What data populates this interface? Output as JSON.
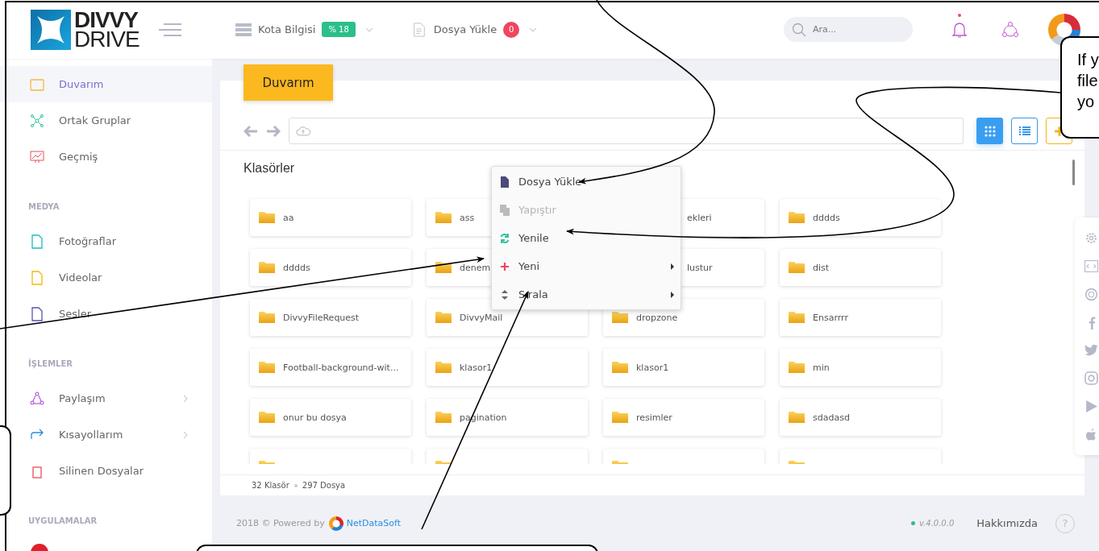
{
  "header": {
    "logo": {
      "line1": "DIVVY",
      "line2": "DRIVE"
    },
    "quota": {
      "label": "Kota Bilgisi",
      "badge": "% 18"
    },
    "upload": {
      "label": "Dosya Yükle",
      "badge": "0"
    },
    "search": {
      "placeholder": "Ara..."
    },
    "has_notification": true
  },
  "sidebar": {
    "sections": [
      {
        "items": [
          {
            "label": "Duvarım",
            "kind": "wall",
            "selected": true,
            "has_submenu": false
          },
          {
            "label": "Ortak Gruplar",
            "kind": "groups",
            "selected": false,
            "has_submenu": false
          },
          {
            "label": "Geçmiş",
            "kind": "history",
            "selected": false,
            "has_submenu": false
          }
        ]
      },
      {
        "title": "MEDYA",
        "items": [
          {
            "label": "Fotoğraflar",
            "kind": "photos",
            "selected": false,
            "has_submenu": false
          },
          {
            "label": "Videolar",
            "kind": "videos",
            "selected": false,
            "has_submenu": false
          },
          {
            "label": "Sesler",
            "kind": "audio",
            "selected": false,
            "has_submenu": false
          }
        ]
      },
      {
        "title": "İŞLEMLER",
        "items": [
          {
            "label": "Paylaşım",
            "kind": "share",
            "selected": false,
            "has_submenu": true
          },
          {
            "label": "Kısayollarım",
            "kind": "shortcut",
            "selected": false,
            "has_submenu": true
          },
          {
            "label": "Silinen Dosyalar",
            "kind": "trash",
            "selected": false,
            "has_submenu": false
          }
        ]
      },
      {
        "title": "UYGULAMALAR"
      }
    ]
  },
  "page": {
    "title": "Duvarım",
    "section_title": "Klasörler",
    "folders": [
      {
        "name": "aa",
        "kind": "folder"
      },
      {
        "name": "ass",
        "kind": "folder"
      },
      {
        "name": "ekleri",
        "kind": "covered"
      },
      {
        "name": "dddds",
        "kind": "folder"
      },
      {
        "name": "dddds",
        "kind": "folder"
      },
      {
        "name": "denem",
        "kind": "folder"
      },
      {
        "name": "lustur",
        "kind": "covered"
      },
      {
        "name": "dist",
        "kind": "folder"
      },
      {
        "name": "DivvyFileRequest",
        "kind": "folder"
      },
      {
        "name": "DivvyMail",
        "kind": "folder"
      },
      {
        "name": "dropzone",
        "kind": "folder"
      },
      {
        "name": "Ensarrrr",
        "kind": "folder"
      },
      {
        "name": "Football-background-wit...",
        "kind": "folder"
      },
      {
        "name": "klasor1",
        "kind": "folder"
      },
      {
        "name": "klasor1",
        "kind": "folder"
      },
      {
        "name": "min",
        "kind": "folder"
      },
      {
        "name": "onur bu dosya",
        "kind": "folder"
      },
      {
        "name": "pagination",
        "kind": "folder"
      },
      {
        "name": "resimler",
        "kind": "folder"
      },
      {
        "name": "sdadasd",
        "kind": "folder"
      },
      {
        "kind": "clipped"
      },
      {
        "kind": "clipped"
      },
      {
        "kind": "clipped"
      },
      {
        "kind": "clipped"
      }
    ],
    "status": {
      "folders": "32 Klasör",
      "files": "297 Dosya"
    }
  },
  "context_menu": {
    "items": [
      {
        "label": "Dosya Yükle",
        "kind": "upload",
        "disabled": false,
        "has_submenu": false
      },
      {
        "label": "Yapıştır",
        "kind": "paste",
        "disabled": true,
        "has_submenu": false
      },
      {
        "label": "Yenile",
        "kind": "refresh",
        "disabled": false,
        "has_submenu": false
      },
      {
        "label": "Yeni",
        "kind": "new",
        "disabled": false,
        "has_submenu": true
      },
      {
        "label": "Sırala",
        "kind": "sort",
        "disabled": false,
        "has_submenu": true
      }
    ]
  },
  "footer": {
    "copyright": "2018 © Powered by",
    "brand": "NetDataSoft",
    "version": "v.4.0.0.0",
    "about": "Hakkımızda",
    "help": "?"
  },
  "annotations": {
    "callouts": [
      {
        "lines": [
          "If y",
          "file",
          "yo"
        ]
      }
    ]
  }
}
